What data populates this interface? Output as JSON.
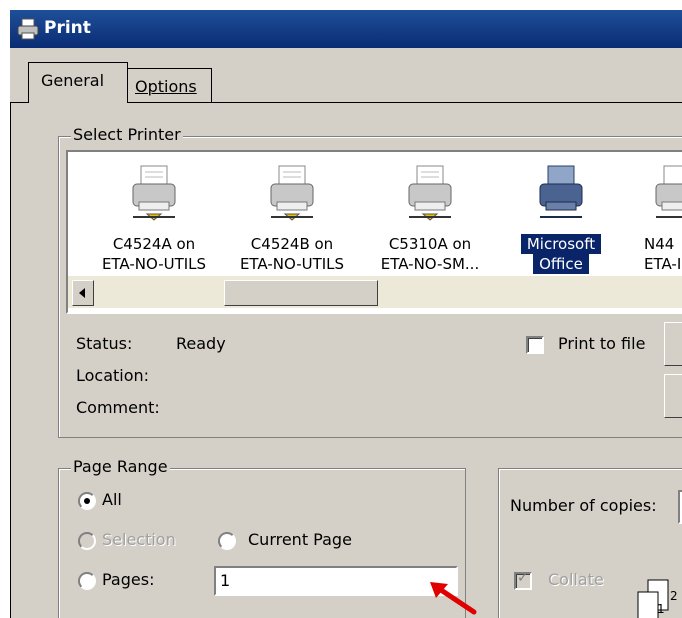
{
  "window": {
    "title": "Print"
  },
  "tabs": [
    {
      "label": "General",
      "active": true
    },
    {
      "label": "Options",
      "active": false
    }
  ],
  "select_printer": {
    "label": "Select Printer",
    "printers": [
      {
        "line1": "C4524A on",
        "line2": "ETA-NO-UTILS",
        "selected": false
      },
      {
        "line1": "C4524B on",
        "line2": "ETA-NO-UTILS",
        "selected": false
      },
      {
        "line1": "C5310A on",
        "line2": "ETA-NO-SM...",
        "selected": false
      },
      {
        "line1": "Microsoft",
        "line2": "Office",
        "selected": true
      },
      {
        "line1": "N44",
        "line2": "ETA-I",
        "selected": false
      }
    ],
    "status_label": "Status:",
    "status_value": "Ready",
    "location_label": "Location:",
    "comment_label": "Comment:",
    "print_to_file_label": "Print to file"
  },
  "page_range": {
    "label": "Page Range",
    "all_label": "All",
    "selection_label": "Selection",
    "current_page_label": "Current Page",
    "pages_label": "Pages:",
    "pages_value": "1"
  },
  "copies": {
    "number_label": "Number of copies:",
    "collate_label": "Collate",
    "collate_icon_digits": [
      "1",
      "2"
    ]
  },
  "icons": {
    "app": "printer-icon",
    "printer": "printer-icon",
    "annotation": "red-arrow-icon"
  },
  "colors": {
    "titlebar": "#0a2c74",
    "selection": "#0a246a",
    "dialog_bg": "#d4d0c8",
    "annotation_arrow": "#e00000"
  }
}
